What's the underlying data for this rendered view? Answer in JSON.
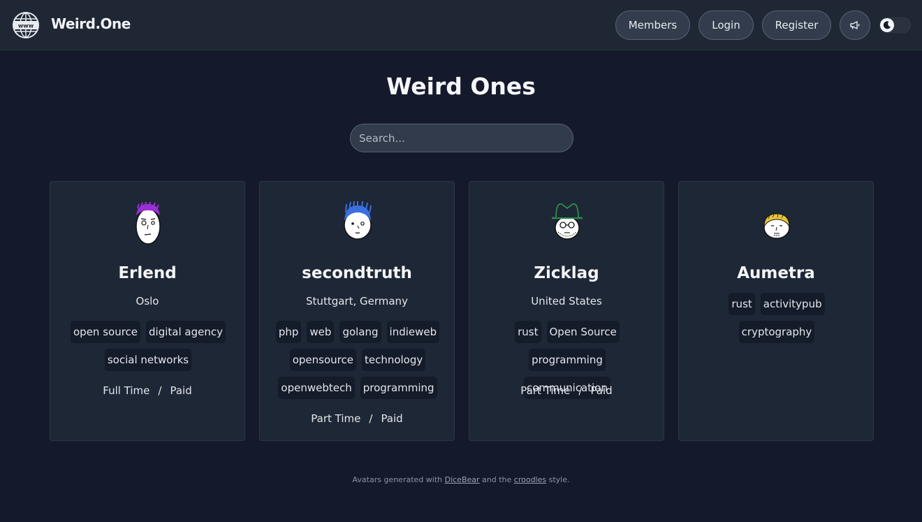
{
  "nav": {
    "brand": "Weird.One",
    "logo_text": "www",
    "members_label": "Members",
    "login_label": "Login",
    "register_label": "Register",
    "announce_icon": "megaphone-icon",
    "theme_toggle_icon": "moon-icon"
  },
  "page": {
    "title": "Weird Ones",
    "search_placeholder": "Search..."
  },
  "members": [
    {
      "name": "Erlend",
      "location": "Oslo",
      "tags": [
        "open source",
        "digital agency",
        "social networks"
      ],
      "work_hours": "Full Time",
      "separator": "/",
      "compensation": "Paid",
      "hair_color": "#9b2fd6"
    },
    {
      "name": "secondtruth",
      "location": "Stuttgart, Germany",
      "tags": [
        "php",
        "web",
        "golang",
        "indieweb",
        "opensource",
        "technology",
        "openwebtech",
        "programming"
      ],
      "work_hours": "Part Time",
      "separator": "/",
      "compensation": "Paid",
      "hair_color": "#3b6fe0"
    },
    {
      "name": "Zicklag",
      "location": "United States",
      "tags": [
        "rust",
        "Open Source",
        "programming",
        "communication"
      ],
      "work_hours": "Part Time",
      "separator": "/",
      "compensation": "Paid",
      "hair_color": "#2f8a4f"
    },
    {
      "name": "Aumetra",
      "location": "",
      "tags": [
        "rust",
        "activitypub",
        "cryptography"
      ],
      "work_hours": "",
      "separator": "",
      "compensation": "",
      "hair_color": "#e8c43a"
    }
  ],
  "footer": {
    "prefix": "Avatars generated with",
    "link1": "DiceBear",
    "middle": "and the",
    "link2": "croodles",
    "suffix": "style."
  }
}
